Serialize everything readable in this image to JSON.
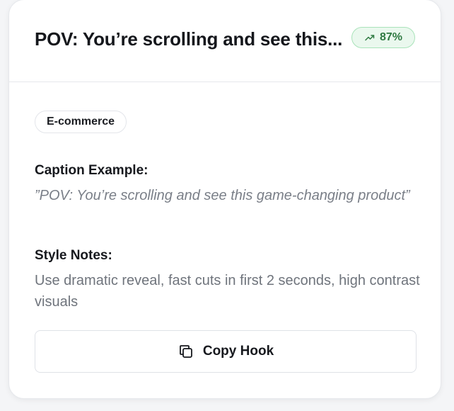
{
  "card": {
    "title": "POV: You’re scrolling and see this...",
    "score": {
      "icon": "trending-up-icon",
      "value": "87%",
      "color": "#2f7a42",
      "background": "#eaf8ee"
    },
    "tag": "E-commerce",
    "caption": {
      "label": "Caption Example:",
      "text": "”POV: You’re scrolling and see this game-changing product”"
    },
    "style_notes": {
      "label": "Style Notes:",
      "text": "Use dramatic reveal, fast cuts in first 2 seconds, high contrast visuals"
    },
    "copy_button": {
      "icon": "copy-icon",
      "label": "Copy Hook"
    }
  }
}
